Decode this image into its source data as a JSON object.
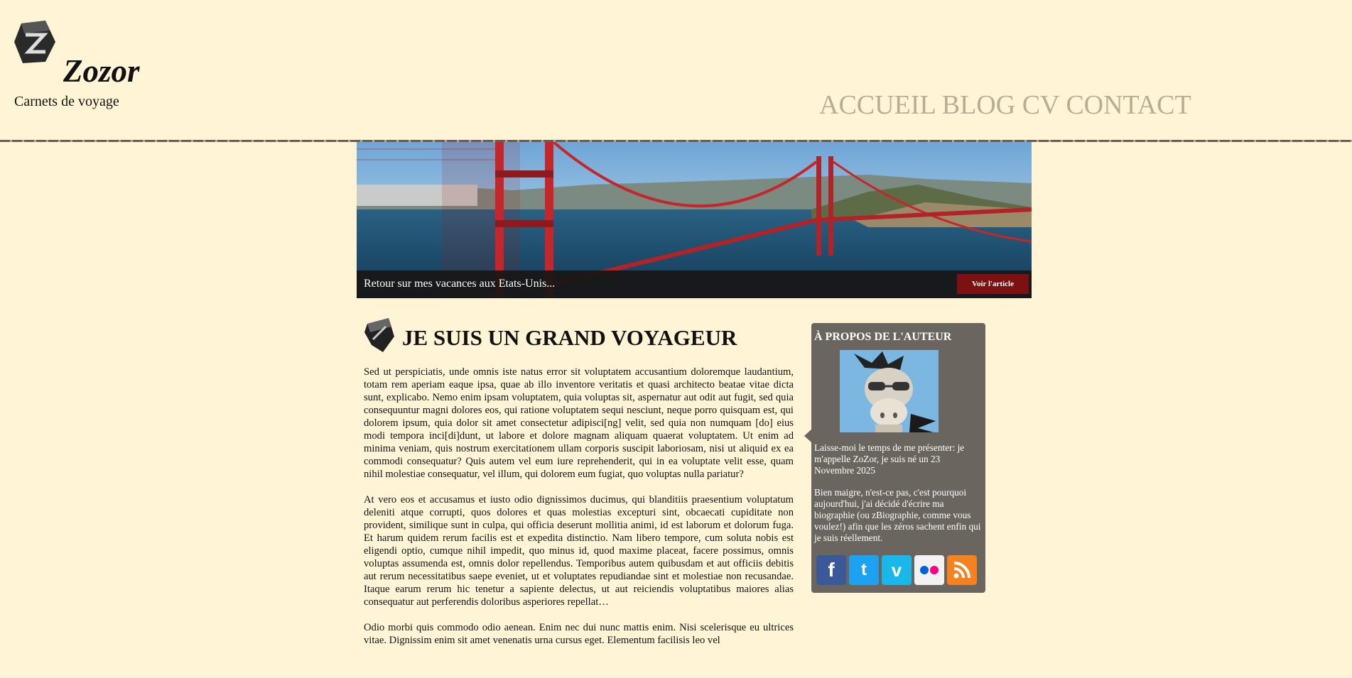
{
  "header": {
    "site_title": "Zozor",
    "site_subtitle": "Carnets de voyage"
  },
  "nav": {
    "items": [
      "ACCUEIL",
      "BLOG",
      "CV",
      "CONTACT"
    ]
  },
  "banner": {
    "caption": "Retour sur mes vacances aux Etats-Unis...",
    "button_label": "Voir l'article"
  },
  "article": {
    "title": "JE SUIS UN GRAND VOYAGEUR",
    "paragraphs": [
      "Sed ut perspiciatis, unde omnis iste natus error sit voluptatem accusantium doloremque laudantium, totam rem aperiam eaque ipsa, quae ab illo inventore veritatis et quasi architecto beatae vitae dicta sunt, explicabo. Nemo enim ipsam voluptatem, quia voluptas sit, aspernatur aut odit aut fugit, sed quia consequuntur magni dolores eos, qui ratione voluptatem sequi nesciunt, neque porro quisquam est, qui dolorem ipsum, quia dolor sit amet consectetur adipisci[ng] velit, sed quia non numquam [do] eius modi tempora inci[di]dunt, ut labore et dolore magnam aliquam quaerat voluptatem. Ut enim ad minima veniam, quis nostrum exercitationem ullam corporis suscipit laboriosam, nisi ut aliquid ex ea commodi consequatur? Quis autem vel eum iure reprehenderit, qui in ea voluptate velit esse, quam nihil molestiae consequatur, vel illum, qui dolorem eum fugiat, quo voluptas nulla pariatur?",
      "At vero eos et accusamus et iusto odio dignissimos ducimus, qui blanditiis praesentium voluptatum deleniti atque corrupti, quos dolores et quas molestias excepturi sint, obcaecati cupiditate non provident, similique sunt in culpa, qui officia deserunt mollitia animi, id est laborum et dolorum fuga. Et harum quidem rerum facilis est et expedita distinctio. Nam libero tempore, cum soluta nobis est eligendi optio, cumque nihil impedit, quo minus id, quod maxime placeat, facere possimus, omnis voluptas assumenda est, omnis dolor repellendus. Temporibus autem quibusdam et aut officiis debitis aut rerum necessitatibus saepe eveniet, ut et voluptates repudiandae sint et molestiae non recusandae. Itaque earum rerum hic tenetur a sapiente delectus, ut aut reiciendis voluptatibus maiores alias consequatur aut perferendis doloribus asperiores repellat…",
      "Odio morbi quis commodo odio aenean. Enim nec dui nunc mattis enim. Nisi scelerisque eu ultrices vitae. Dignissim enim sit amet venenatis urna cursus eget. Elementum facilisis leo vel"
    ]
  },
  "sidebar": {
    "title": "À PROPOS DE L'AUTEUR",
    "intro": "Laisse-moi le temps de me présenter: je m'appelle ZoZor, je suis né un 23 Novembre 2025",
    "bio": "Bien maigre, n'est-ce pas, c'est pourquoi aujourd'hui, j'ai décidé d'écrire ma biographie (ou zBiographie, comme vous voulez!) afin que les zéros sachent enfin qui je suis réellement."
  },
  "social": [
    {
      "icon": "facebook-icon",
      "color": "#3b5998",
      "glyph": "f"
    },
    {
      "icon": "twitter-icon",
      "color": "#1da1f2",
      "glyph": "t"
    },
    {
      "icon": "vimeo-icon",
      "color": "#1ab7ea",
      "glyph": "v"
    },
    {
      "icon": "flickr-icon",
      "color": "#f2f2f2",
      "glyph": ""
    },
    {
      "icon": "rss-icon",
      "color": "#f5821f",
      "glyph": ""
    }
  ]
}
